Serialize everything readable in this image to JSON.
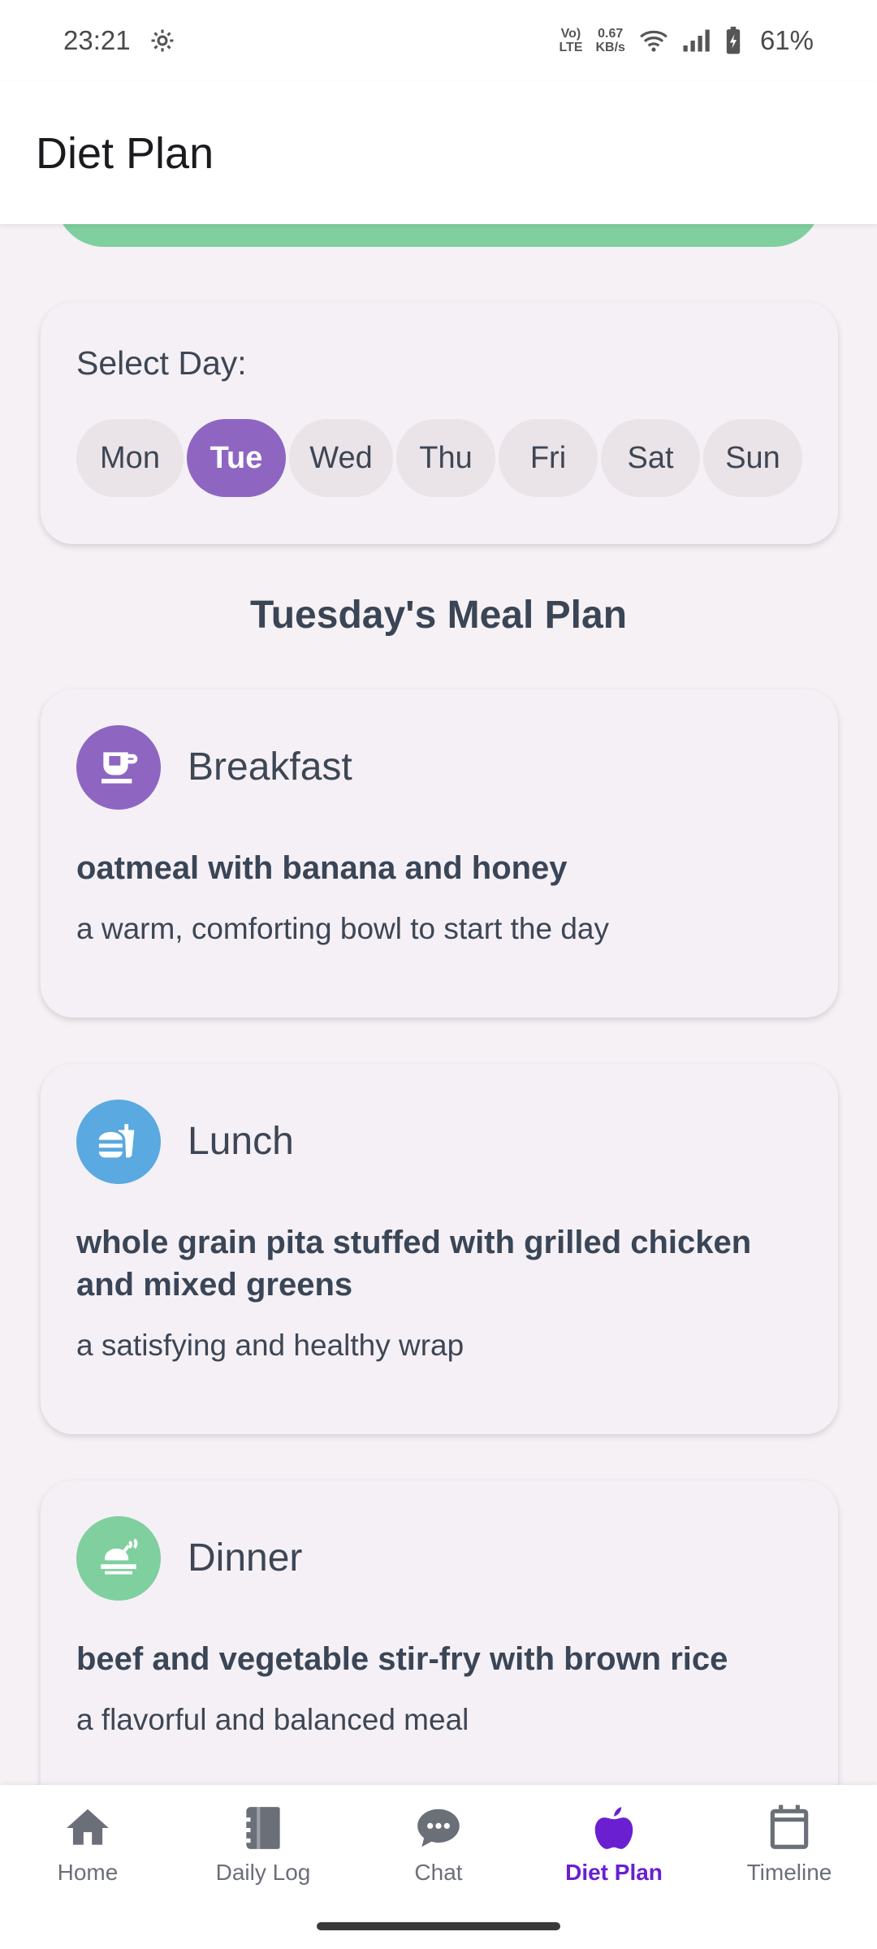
{
  "status_bar": {
    "time": "23:21",
    "network_speed_value": "0.67",
    "network_speed_unit": "KB/s",
    "volte_top": "Vo)",
    "volte_bottom": "LTE",
    "battery_percent": "61%"
  },
  "app_bar": {
    "title": "Diet Plan"
  },
  "day_selector": {
    "label": "Select Day:",
    "days": [
      "Mon",
      "Tue",
      "Wed",
      "Thu",
      "Fri",
      "Sat",
      "Sun"
    ],
    "selected": "Tue"
  },
  "meal_plan": {
    "title": "Tuesday's Meal Plan",
    "meals": [
      {
        "name": "Breakfast",
        "dish": "oatmeal with banana and honey",
        "description": "a warm, comforting bowl to start the day",
        "icon": "coffee-cup-icon",
        "color": "#8e66c2"
      },
      {
        "name": "Lunch",
        "dish": "whole grain pita stuffed with grilled chicken and mixed greens",
        "description": "a satisfying and healthy wrap",
        "icon": "fastfood-icon",
        "color": "#5aa9e0"
      },
      {
        "name": "Dinner",
        "dish": "beef and vegetable stir-fry with brown rice",
        "description": "a flavorful and balanced meal",
        "icon": "dinner-dining-icon",
        "color": "#7fcf9f"
      }
    ]
  },
  "bottom_nav": {
    "items": [
      {
        "label": "Home",
        "icon": "home-icon"
      },
      {
        "label": "Daily Log",
        "icon": "journal-icon"
      },
      {
        "label": "Chat",
        "icon": "chat-bubble-icon"
      },
      {
        "label": "Diet Plan",
        "icon": "apple-icon"
      },
      {
        "label": "Timeline",
        "icon": "calendar-icon"
      }
    ],
    "active": "Diet Plan"
  },
  "colors": {
    "accent": "#8e66c2",
    "nav_active": "#6a1fd1",
    "green": "#7fcf9f",
    "blue": "#5aa9e0"
  }
}
